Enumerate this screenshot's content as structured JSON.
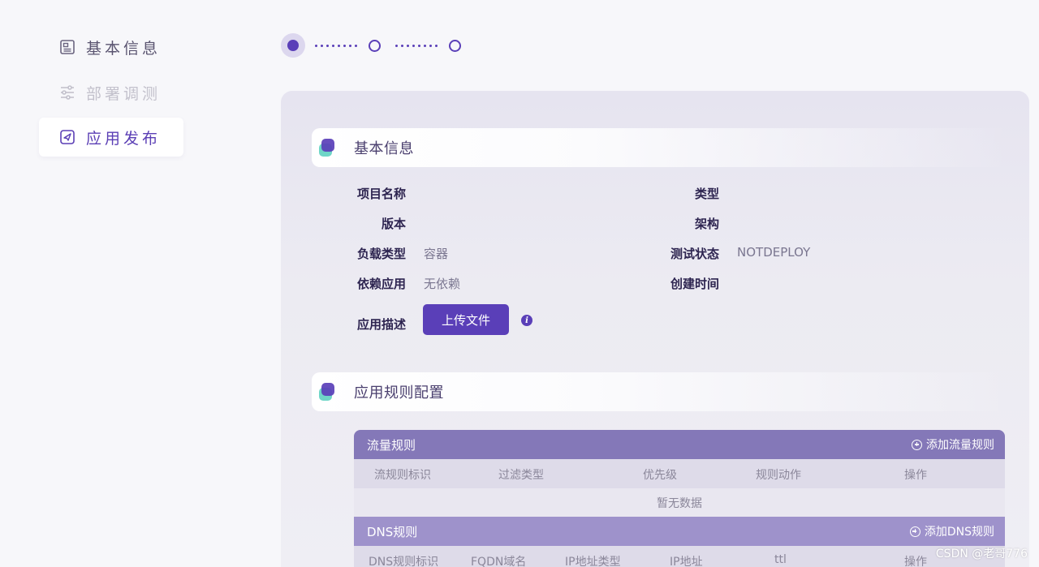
{
  "sidebar": {
    "items": [
      {
        "label": "基本信息",
        "icon": "profile-card-icon",
        "state": "normal"
      },
      {
        "label": "部署调测",
        "icon": "sliders-icon",
        "state": "disabled"
      },
      {
        "label": "应用发布",
        "icon": "send-icon",
        "state": "active"
      }
    ]
  },
  "stepper": {
    "steps": 3,
    "current": 1
  },
  "basic_info": {
    "title": "基本信息",
    "fields": {
      "project_name_label": "项目名称",
      "project_name_value": "",
      "type_label": "类型",
      "type_value": "",
      "version_label": "版本",
      "version_value": "",
      "arch_label": "架构",
      "arch_value": "",
      "load_type_label": "负载类型",
      "load_type_value": "容器",
      "test_status_label": "测试状态",
      "test_status_value": "NOTDEPLOY",
      "dependency_label": "依赖应用",
      "dependency_value": "无依赖",
      "created_time_label": "创建时间",
      "created_time_value": "",
      "description_label": "应用描述"
    },
    "upload_button": "上传文件"
  },
  "rules_config": {
    "title": "应用规则配置",
    "traffic": {
      "title": "流量规则",
      "add_label": "添加流量规则",
      "columns": [
        "流规则标识",
        "过滤类型",
        "优先级",
        "规则动作",
        "操作"
      ],
      "empty_text": "暂无数据"
    },
    "dns": {
      "title": "DNS规则",
      "add_label": "添加DNS规则",
      "columns": [
        "DNS规则标识",
        "FQDN域名",
        "IP地址类型",
        "IP地址",
        "ttl",
        "操作"
      ]
    }
  },
  "watermark": "CSDN @老哥776",
  "colors": {
    "accent": "#5a3fb8",
    "table_header": "#8478b8",
    "teal": "#6fd6c7"
  }
}
